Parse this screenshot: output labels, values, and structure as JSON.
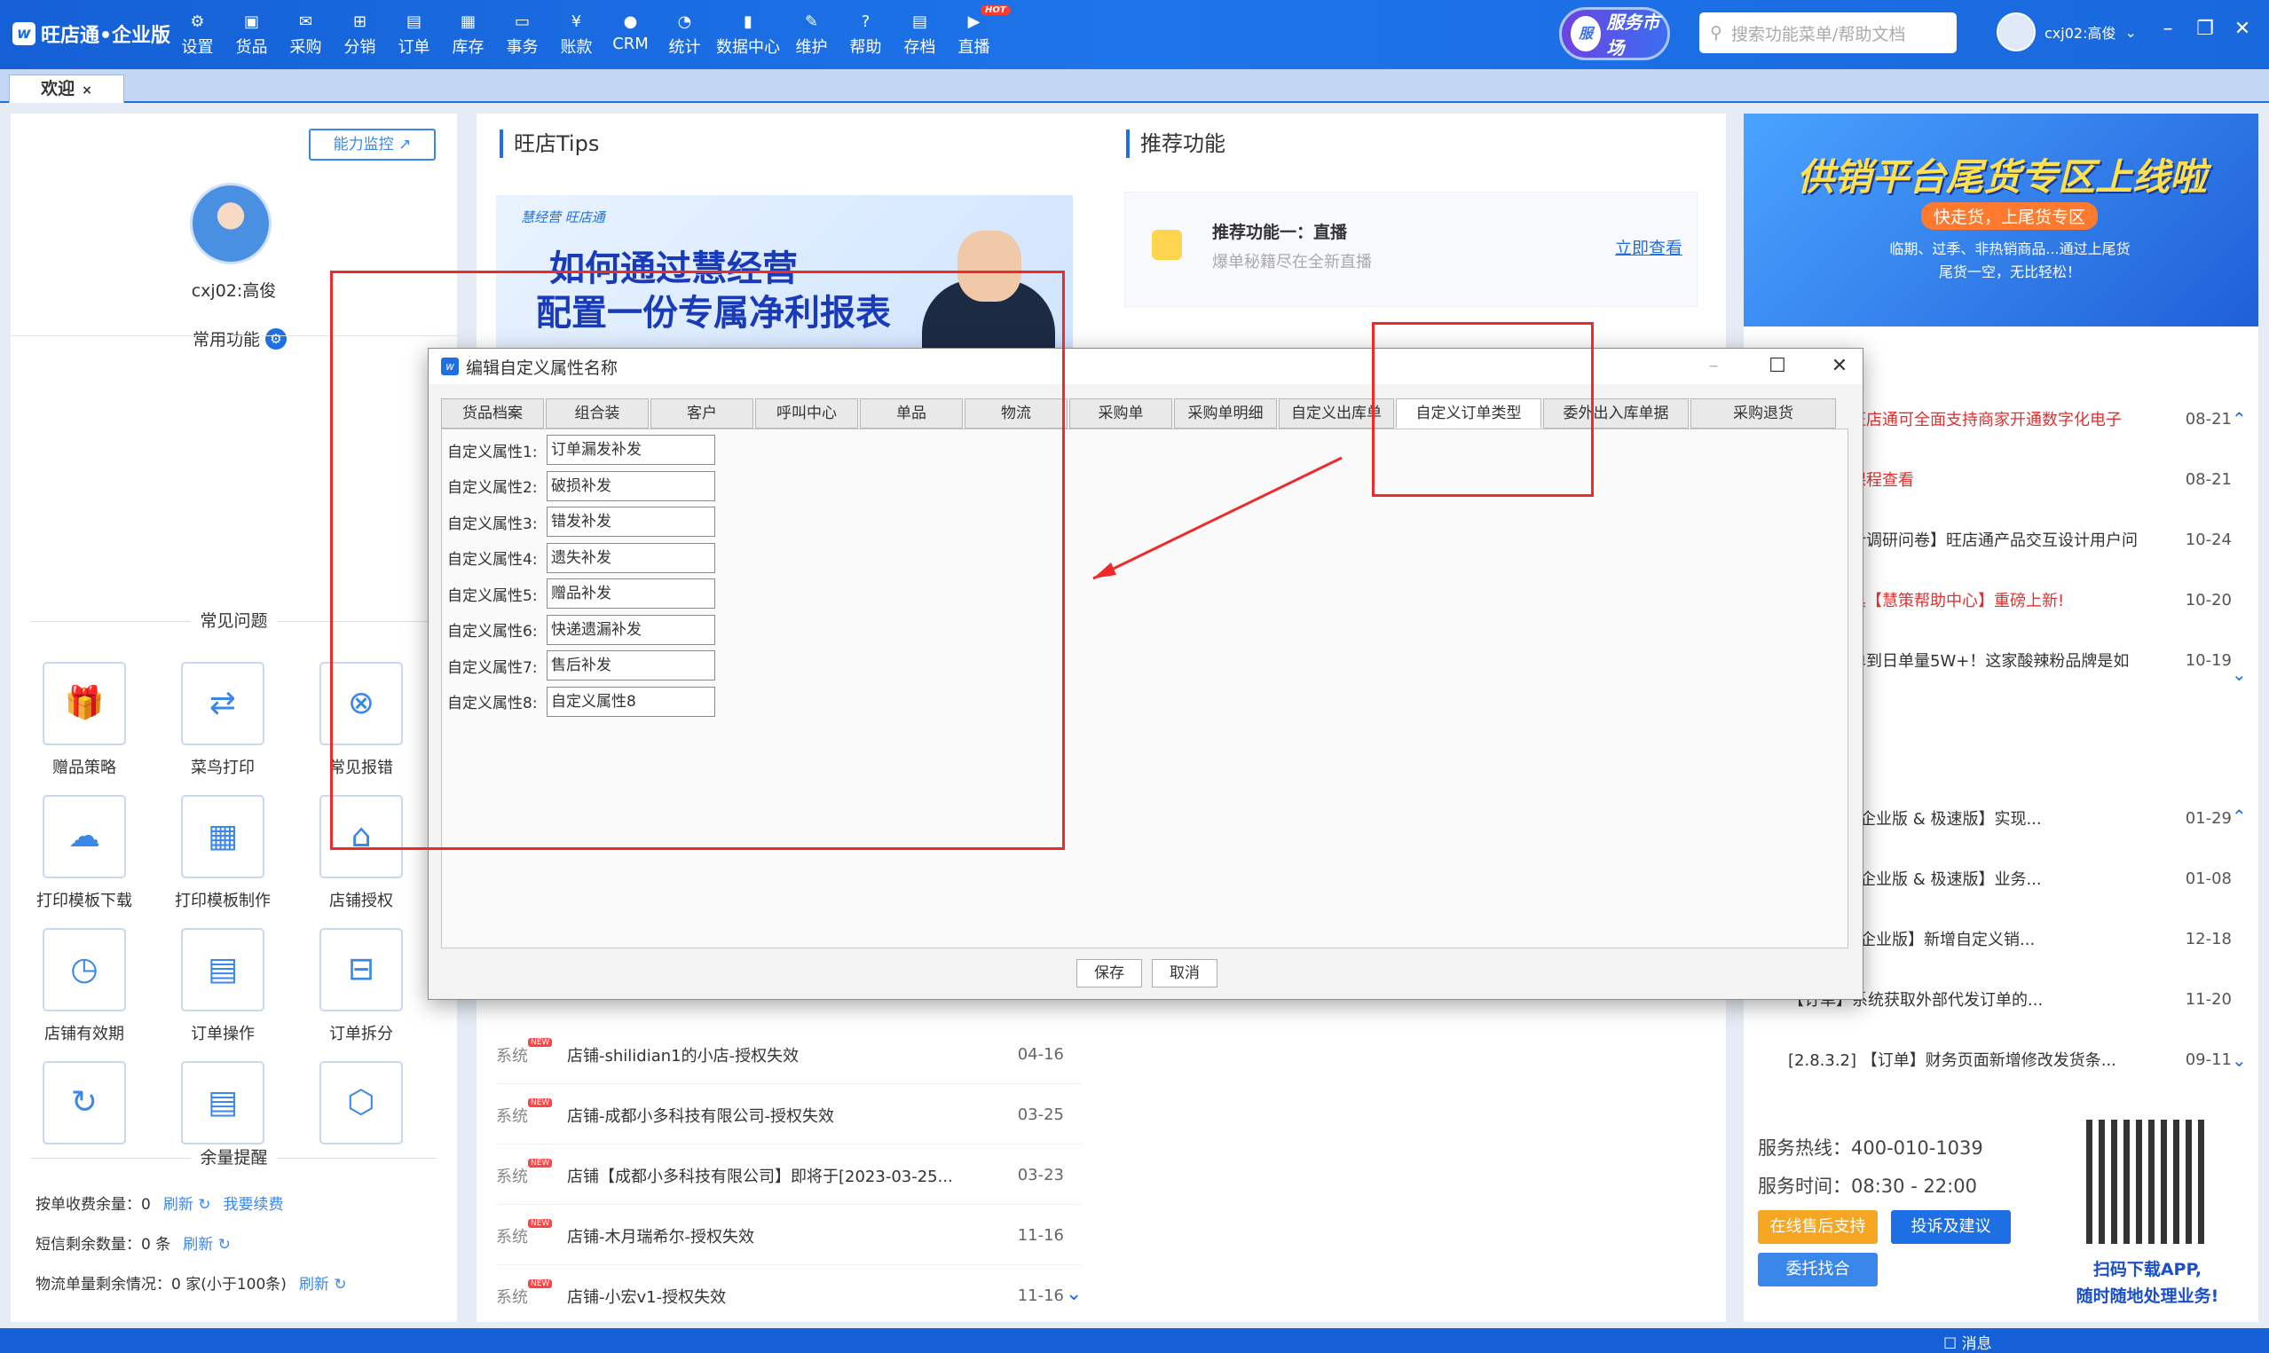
{
  "app": {
    "brand": "旺店通•企业版"
  },
  "nav": [
    {
      "label": "设置",
      "icon": "⚙"
    },
    {
      "label": "货品",
      "icon": "▣"
    },
    {
      "label": "采购",
      "icon": "✉"
    },
    {
      "label": "分销",
      "icon": "⊞"
    },
    {
      "label": "订单",
      "icon": "▤"
    },
    {
      "label": "库存",
      "icon": "▦"
    },
    {
      "label": "事务",
      "icon": "▭"
    },
    {
      "label": "账款",
      "icon": "¥"
    },
    {
      "label": "CRM",
      "icon": "●"
    },
    {
      "label": "统计",
      "icon": "◔"
    },
    {
      "label": "数据中心",
      "icon": "▮"
    },
    {
      "label": "维护",
      "icon": "✎"
    },
    {
      "label": "帮助",
      "icon": "?"
    },
    {
      "label": "存档",
      "icon": "▤"
    },
    {
      "label": "直播",
      "icon": "▶",
      "badge": "HOT"
    }
  ],
  "service_market": "服务市场",
  "search": {
    "placeholder": "搜索功能菜单/帮助文档"
  },
  "user": {
    "name": "cxj02:高俊"
  },
  "tabs": {
    "welcome": "欢迎",
    "close": "×"
  },
  "left": {
    "monitor_btn": "能力监控 ↗",
    "username": "cxj02:高俊",
    "common_functions": "常用功能",
    "faq_title": "常见问题",
    "tiles": [
      {
        "label": "赠品策略",
        "icon": "🎁"
      },
      {
        "label": "菜鸟打印",
        "icon": "⇄"
      },
      {
        "label": "常见报错",
        "icon": "⊗"
      },
      {
        "label": "打印模板下载",
        "icon": "☁"
      },
      {
        "label": "打印模板制作",
        "icon": "▦"
      },
      {
        "label": "店铺授权",
        "icon": "⌂"
      },
      {
        "label": "店铺有效期",
        "icon": "◷"
      },
      {
        "label": "订单操作",
        "icon": "▤"
      },
      {
        "label": "订单拆分",
        "icon": "⊟"
      },
      {
        "label": "",
        "icon": "↻"
      },
      {
        "label": "",
        "icon": "▤"
      },
      {
        "label": "",
        "icon": "⬡"
      }
    ],
    "balance_title": "余量提醒",
    "balance": [
      {
        "text": "按单收费余量：0",
        "link": "刷新",
        "link2": "我要续费"
      },
      {
        "text": "短信剩余数量：0 条",
        "link": "刷新",
        "link2": ""
      },
      {
        "text": "物流单量剩余情况：0 家(小于100条)",
        "link": "刷新",
        "link2": ""
      }
    ]
  },
  "mid": {
    "tips_title": "旺店Tips",
    "recommend_title": "推荐功能",
    "banner": {
      "brand": "慧经营 旺店通",
      "line1": "如何通过慧经营",
      "line2": "配置一份专属净利报表"
    },
    "recommend": {
      "title": "推荐功能一：直播",
      "subtitle": "爆单秘籍尽在全新直播",
      "link": "立即查看"
    },
    "messages": [
      {
        "kind": "系统",
        "text": "店铺-shilidian1的小店-授权失效",
        "date": "04-16"
      },
      {
        "kind": "系统",
        "text": "店铺-成都小多科技有限公司-授权失效",
        "date": "03-25"
      },
      {
        "kind": "系统",
        "text": "店铺【成都小多科技有限公司】即将于[2023-03-25...",
        "date": "03-23"
      },
      {
        "kind": "系统",
        "text": "店铺-木月瑞希尔-授权失效",
        "date": "11-16"
      },
      {
        "kind": "系统",
        "text": "店铺-小宏v1-授权失效",
        "date": "11-16"
      }
    ]
  },
  "right": {
    "ad": {
      "title": "供销平台尾货专区上线啦",
      "pill": "快走货，上尾货专区",
      "desc": "临期、过季、非热销商品...通过上尾货\n尾货一空，无比轻松！"
    },
    "news1": [
      {
        "text": "旺店通可全面支持商家开通数字化电子",
        "date": "08-21",
        "red": true
      },
      {
        "text": "课程查看",
        "date": "08-21",
        "red": true
      },
      {
        "text": "计调研问卷】旺店通产品交互设计用户问",
        "date": "10-24",
        "red": false
      },
      {
        "text": "具【慧策帮助中心】重磅上新!",
        "date": "10-20",
        "red": true
      },
      {
        "text": "单到日单量5W+！这家酸辣粉品牌是如",
        "date": "10-19",
        "red": false
      }
    ],
    "news2": [
      {
        "text": "【设置】【企业版 & 极速版】实现...",
        "date": "01-29"
      },
      {
        "text": "【分销】【企业版 & 极速版】业务...",
        "date": "01-08"
      },
      {
        "text": "【设置】【企业版】新增自定义销...",
        "date": "12-18"
      },
      {
        "text": "【订单】系统获取外部代发订单的...",
        "date": "11-20"
      },
      {
        "text": "[2.8.3.2]  【订单】财务页面新增修改发货条...",
        "date": "09-11"
      }
    ],
    "support": {
      "hotline": "服务热线：400-010-1039",
      "hours": "服务时间：08:30 - 22:00",
      "btn1": "在线售后支持",
      "btn2": "投诉及建议",
      "btn3": "委托找合",
      "qr_text": "扫码下载APP,\n随时随地处理业务!"
    }
  },
  "status": {
    "message": "☐ 消息"
  },
  "dialog": {
    "title": "编辑自定义属性名称",
    "tabs": [
      "货品档案",
      "组合装",
      "客户",
      "呼叫中心",
      "单品",
      "物流",
      "采购单",
      "采购单明细",
      "自定义出库单",
      "自定义订单类型",
      "委外出入库单据",
      "采购退货"
    ],
    "active_tab": "自定义订单类型",
    "fields": [
      {
        "label": "自定义属性1:",
        "value": "订单漏发补发"
      },
      {
        "label": "自定义属性2:",
        "value": "破损补发"
      },
      {
        "label": "自定义属性3:",
        "value": "错发补发"
      },
      {
        "label": "自定义属性4:",
        "value": "遗失补发"
      },
      {
        "label": "自定义属性5:",
        "value": "赠品补发"
      },
      {
        "label": "自定义属性6:",
        "value": "快递遗漏补发"
      },
      {
        "label": "自定义属性7:",
        "value": "售后补发"
      },
      {
        "label": "自定义属性8:",
        "value": "自定义属性8"
      }
    ],
    "save": "保存",
    "cancel": "取消"
  }
}
